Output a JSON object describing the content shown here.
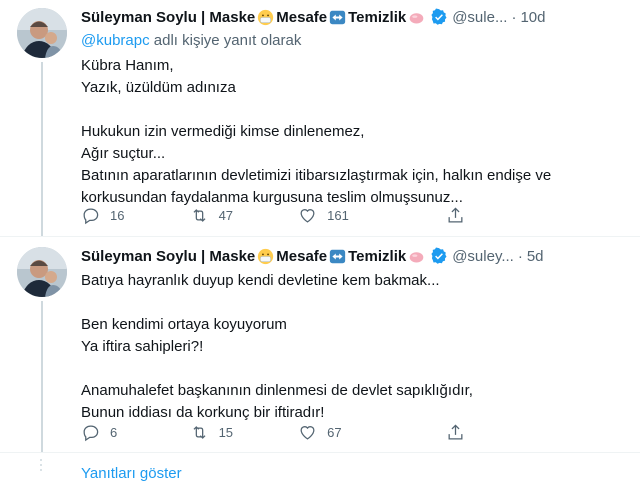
{
  "tweets": [
    {
      "author": {
        "name_part1": "Süleyman Soylu | Maske",
        "name_part2": "Mesafe",
        "name_part3": "Temizlik",
        "handle": "@sule...",
        "avatar_icon": "avatar-photo"
      },
      "time": "10d",
      "reply_prefix": "",
      "reply_handle": "@kubrapc",
      "reply_suffix": "adlı kişiye yanıt olarak",
      "lines": [
        "Kübra Hanım,",
        "Yazık, üzüldüm adınıza",
        "",
        "Hukukun izin vermediği kimse dinlenemez,",
        "Ağır suçtur...",
        "Batının aparatlarının devletimizi itibarsızlaştırmak için, halkın endişe ve",
        "korkusundan faydalanma kurgusuna teslim olmuşsunuz..."
      ],
      "counts": {
        "replies": "16",
        "retweets": "47",
        "likes": "161"
      }
    },
    {
      "author": {
        "name_part1": "Süleyman Soylu | Maske",
        "name_part2": "Mesafe",
        "name_part3": "Temizlik",
        "handle": "@suley...",
        "avatar_icon": "avatar-photo"
      },
      "time": "5d",
      "lines": [
        "Batıya hayranlık duyup kendi devletine kem bakmak...",
        "",
        "Ben kendimi ortaya koyuyorum",
        "Ya iftira sahipleri?!",
        "",
        "Anamuhalefet başkanının dinlenmesi de devlet sapıklığıdır,",
        "Bunun iddiası da korkunç bir iftiradır!"
      ],
      "counts": {
        "replies": "6",
        "retweets": "15",
        "likes": "67"
      }
    }
  ],
  "show_replies": "Yanıtları göster",
  "icons": [
    "mask-emoji-icon",
    "left-right-arrow-emoji-icon",
    "soap-emoji-icon",
    "verified-badge-icon",
    "reply-icon",
    "retweet-icon",
    "like-icon",
    "share-icon"
  ],
  "colors": {
    "accent": "#1d9bf0",
    "muted": "#536471",
    "text": "#0f1419",
    "line": "#cfd9de"
  }
}
